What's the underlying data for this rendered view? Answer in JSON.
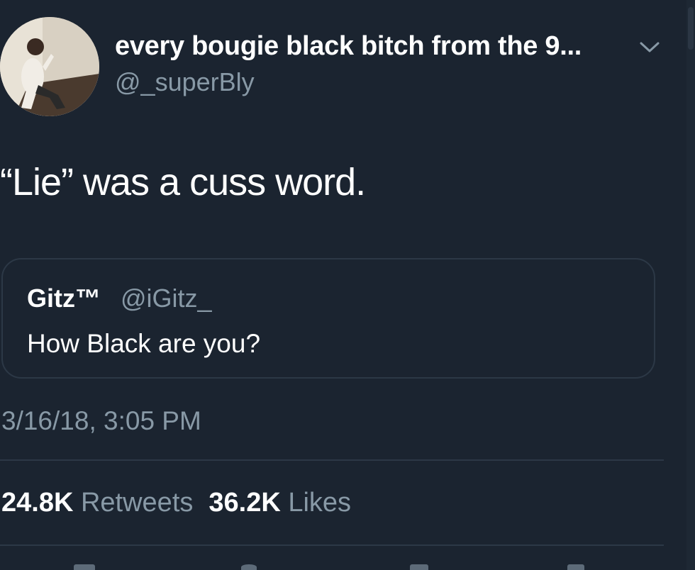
{
  "tweet": {
    "display_name": "every bougie black bitch from the 9...",
    "handle": "@_superBly",
    "text": "“Lie” was a cuss word.",
    "timestamp": "3/16/18, 3:05 PM"
  },
  "quoted_tweet": {
    "display_name": "Gitz™",
    "handle": "@iGitz_",
    "text": "How Black are you?"
  },
  "stats": {
    "retweets_count": "24.8K",
    "retweets_label": "Retweets",
    "likes_count": "36.2K",
    "likes_label": "Likes"
  },
  "icons": {
    "menu": "chevron-down-icon",
    "reply": "reply-icon",
    "retweet": "retweet-icon",
    "like": "heart-icon",
    "share": "share-icon"
  },
  "colors": {
    "background": "#1b2430",
    "text_primary": "#ffffff",
    "text_secondary": "#8899a6",
    "border": "#2c3846"
  }
}
